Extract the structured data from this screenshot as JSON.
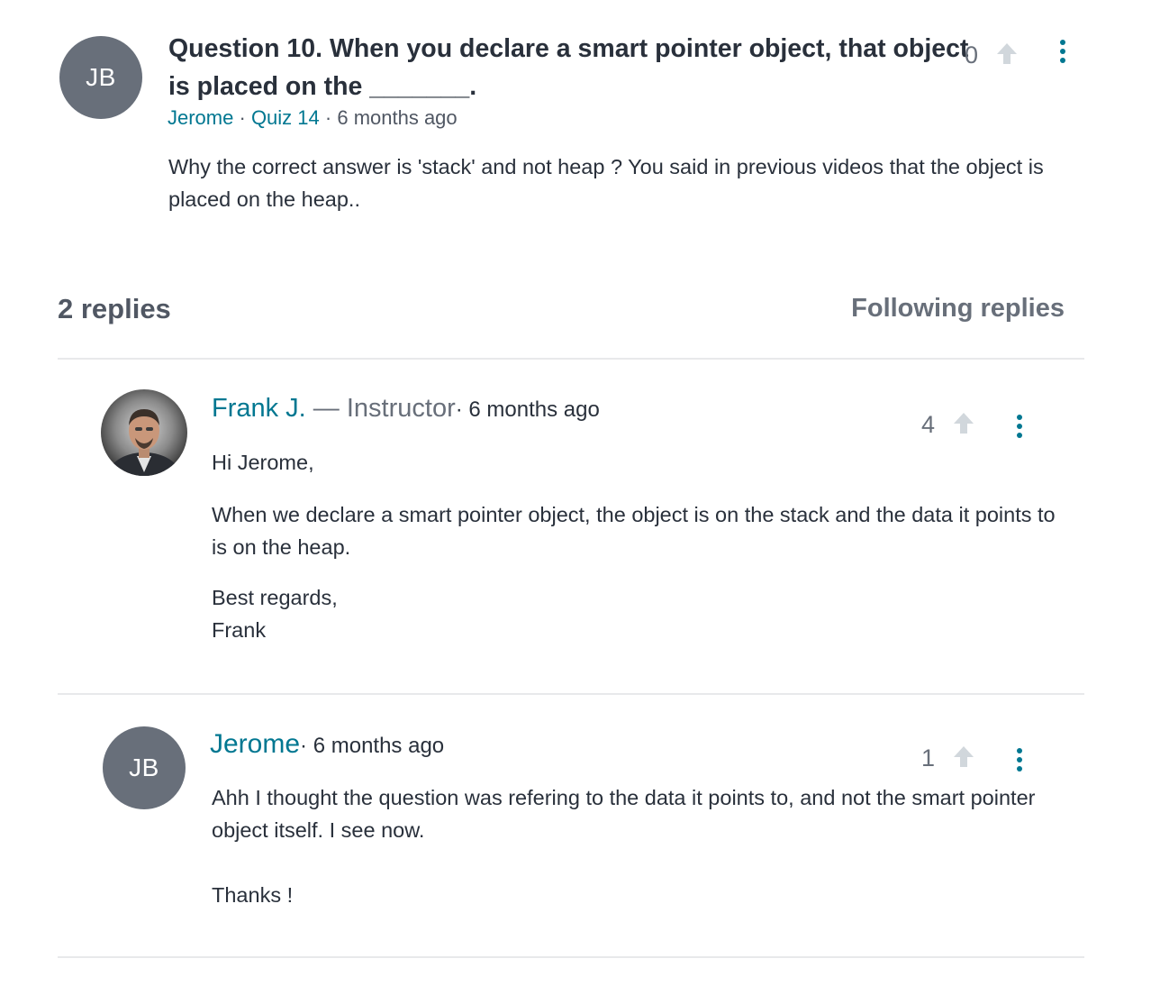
{
  "question": {
    "avatar_initials": "JB",
    "title": "Question 10. When you declare a smart pointer object, that object is placed on the _______.",
    "author": "Jerome",
    "course_item": "Quiz 14",
    "separator": "·",
    "time": "6 months ago",
    "body": "Why the correct answer is 'stack' and not heap ? You said in previous videos that the object is placed on the heap..",
    "votes": "0"
  },
  "replies_section": {
    "count_label": "2 replies",
    "following_label": "Following replies"
  },
  "replies": [
    {
      "author": "Frank J.",
      "role": " — Instructor",
      "time": "· 6 months ago",
      "votes": "4",
      "paragraphs": [
        "Hi Jerome,",
        "When we declare a smart pointer object, the object is on the stack and the data it points to is on the heap.",
        "Best regards,",
        "Frank"
      ]
    },
    {
      "avatar_initials": "JB",
      "author": "Jerome",
      "time": "· 6 months ago",
      "votes": "1",
      "paragraphs": [
        "Ahh I thought the question was refering to the data it points to, and not the smart pointer object itself. I see now.",
        "Thanks !"
      ]
    }
  ],
  "colors": {
    "link": "#007791",
    "avatar_bg": "#686f7a",
    "text": "#29303b",
    "muted": "#686f7a",
    "divider": "#e8e9eb",
    "upvote_icon": "#d1d7dc"
  },
  "icons": {
    "upvote": "arrow-up-icon",
    "more": "kebab-menu-icon"
  }
}
